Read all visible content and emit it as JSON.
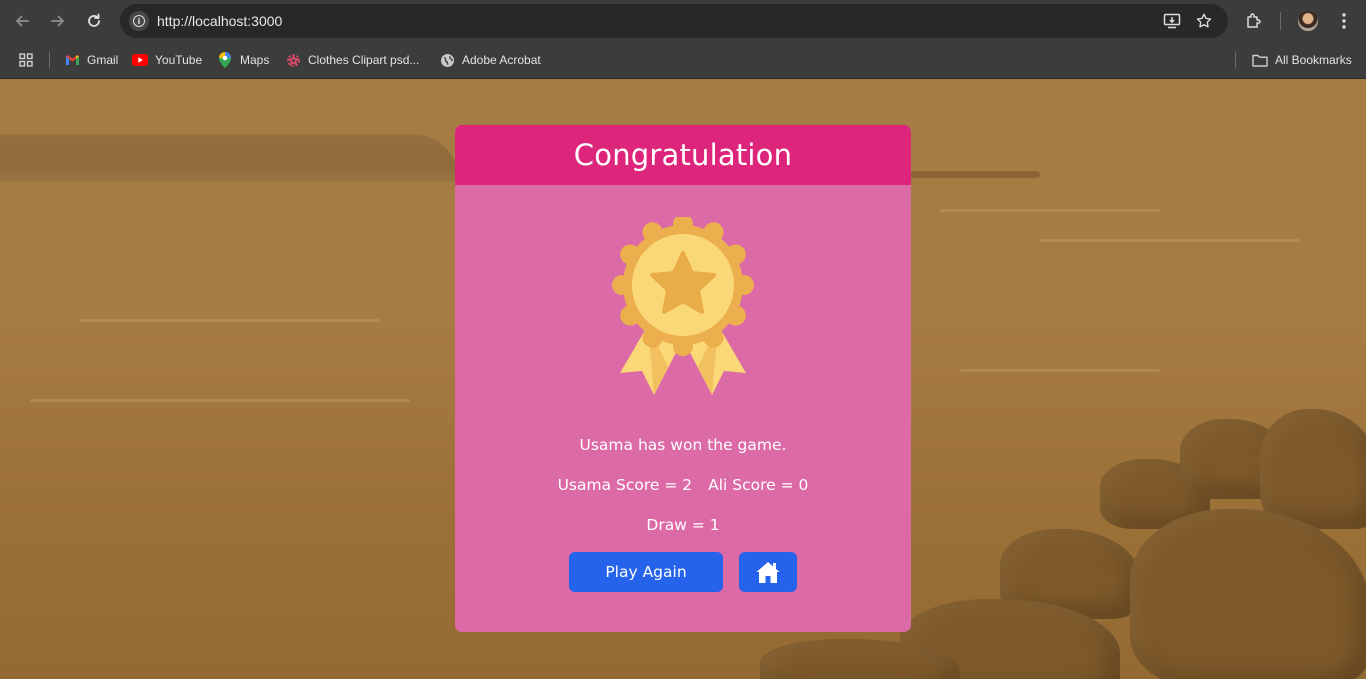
{
  "browser": {
    "url": "http://localhost:3000",
    "bookmarks": [
      {
        "label": "Gmail",
        "icon": "gmail-icon"
      },
      {
        "label": "YouTube",
        "icon": "youtube-icon"
      },
      {
        "label": "Maps",
        "icon": "maps-icon"
      },
      {
        "label": "Clothes Clipart psd...",
        "icon": "clipart-icon"
      },
      {
        "label": "Adobe Acrobat",
        "icon": "globe-icon"
      }
    ],
    "all_bookmarks_label": "All Bookmarks"
  },
  "result": {
    "title": "Congratulation",
    "message": "Usama has won the game.",
    "player1_score": "Usama Score = 2",
    "player2_score": "Ali Score = 0",
    "draw": "Draw = 1",
    "play_again_label": "Play Again",
    "home_icon": "home-icon",
    "badge_icon": "medal-star-icon"
  },
  "colors": {
    "header": "#dc257b",
    "card": "#dc6aa6",
    "button": "#2563eb",
    "medal": "#f2c05e"
  }
}
